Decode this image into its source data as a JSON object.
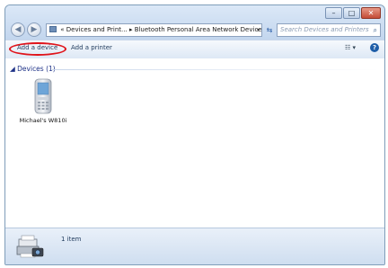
{
  "addressbar": {
    "path": "« Devices and Print... ▸ Bluetooth Personal Area Network Devices",
    "dropdown_glyph": "▾"
  },
  "refresh_glyph": "⇆",
  "search": {
    "placeholder": "Search Devices and Printers",
    "icon": "⌕"
  },
  "window_controls": {
    "minimize": "–",
    "maximize": "□",
    "close": "✕"
  },
  "nav": {
    "back": "◀",
    "forward": "▶"
  },
  "toolbar": {
    "add_device_label": "Add a device",
    "add_printer_label": "Add a printer",
    "view_glyph": "☷ ▾",
    "help_glyph": "?"
  },
  "group": {
    "header": "◢ Devices (1)"
  },
  "devices": [
    {
      "name": "Michael's W810i",
      "icon": "phone-icon"
    }
  ],
  "details": {
    "count": "1 item",
    "icon": "printer-camera-icon"
  },
  "colors": {
    "highlight_oval": "#e0141b",
    "group_header": "#1e3287"
  }
}
